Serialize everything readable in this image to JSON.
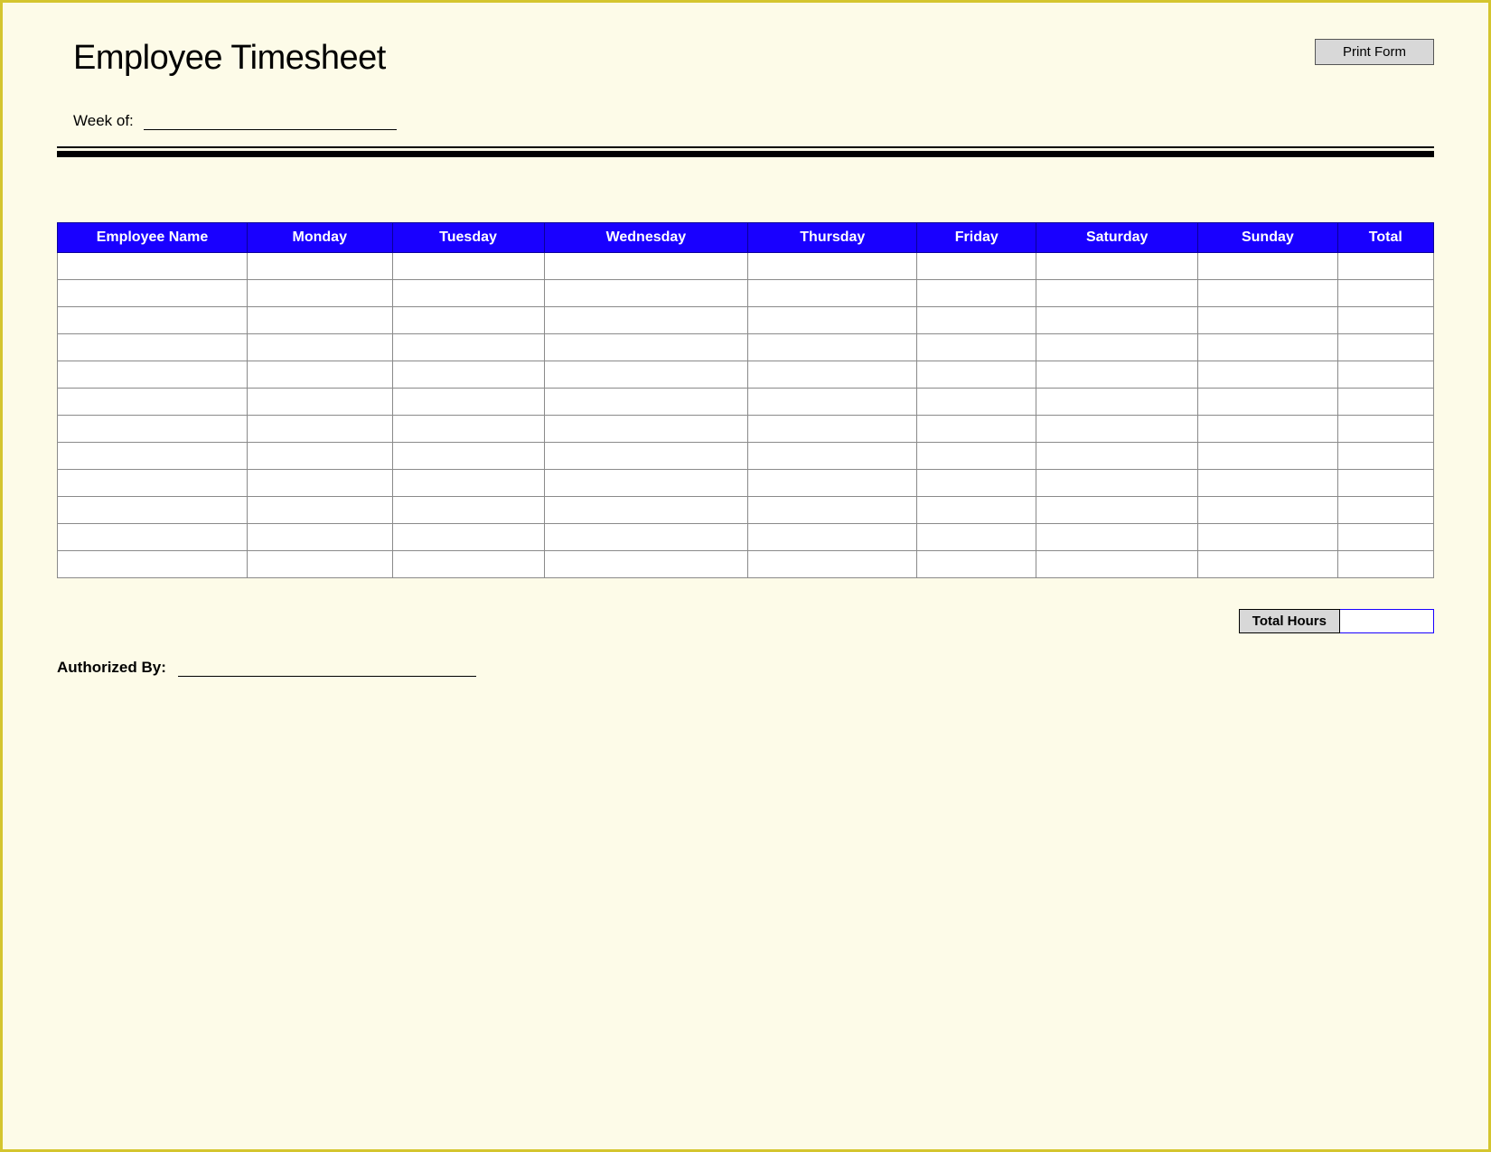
{
  "title": "Employee Timesheet",
  "print_button": "Print Form",
  "week_label": "Week of:",
  "week_value": "",
  "table": {
    "headers": [
      "Employee Name",
      "Monday",
      "Tuesday",
      "Wednesday",
      "Thursday",
      "Friday",
      "Saturday",
      "Sunday",
      "Total"
    ],
    "rows": [
      [
        "",
        "",
        "",
        "",
        "",
        "",
        "",
        "",
        ""
      ],
      [
        "",
        "",
        "",
        "",
        "",
        "",
        "",
        "",
        ""
      ],
      [
        "",
        "",
        "",
        "",
        "",
        "",
        "",
        "",
        ""
      ],
      [
        "",
        "",
        "",
        "",
        "",
        "",
        "",
        "",
        ""
      ],
      [
        "",
        "",
        "",
        "",
        "",
        "",
        "",
        "",
        ""
      ],
      [
        "",
        "",
        "",
        "",
        "",
        "",
        "",
        "",
        ""
      ],
      [
        "",
        "",
        "",
        "",
        "",
        "",
        "",
        "",
        ""
      ],
      [
        "",
        "",
        "",
        "",
        "",
        "",
        "",
        "",
        ""
      ],
      [
        "",
        "",
        "",
        "",
        "",
        "",
        "",
        "",
        ""
      ],
      [
        "",
        "",
        "",
        "",
        "",
        "",
        "",
        "",
        ""
      ],
      [
        "",
        "",
        "",
        "",
        "",
        "",
        "",
        "",
        ""
      ],
      [
        "",
        "",
        "",
        "",
        "",
        "",
        "",
        "",
        ""
      ]
    ]
  },
  "total_hours_label": "Total Hours",
  "total_hours_value": "",
  "authorized_by_label": "Authorized By:",
  "authorized_by_value": ""
}
